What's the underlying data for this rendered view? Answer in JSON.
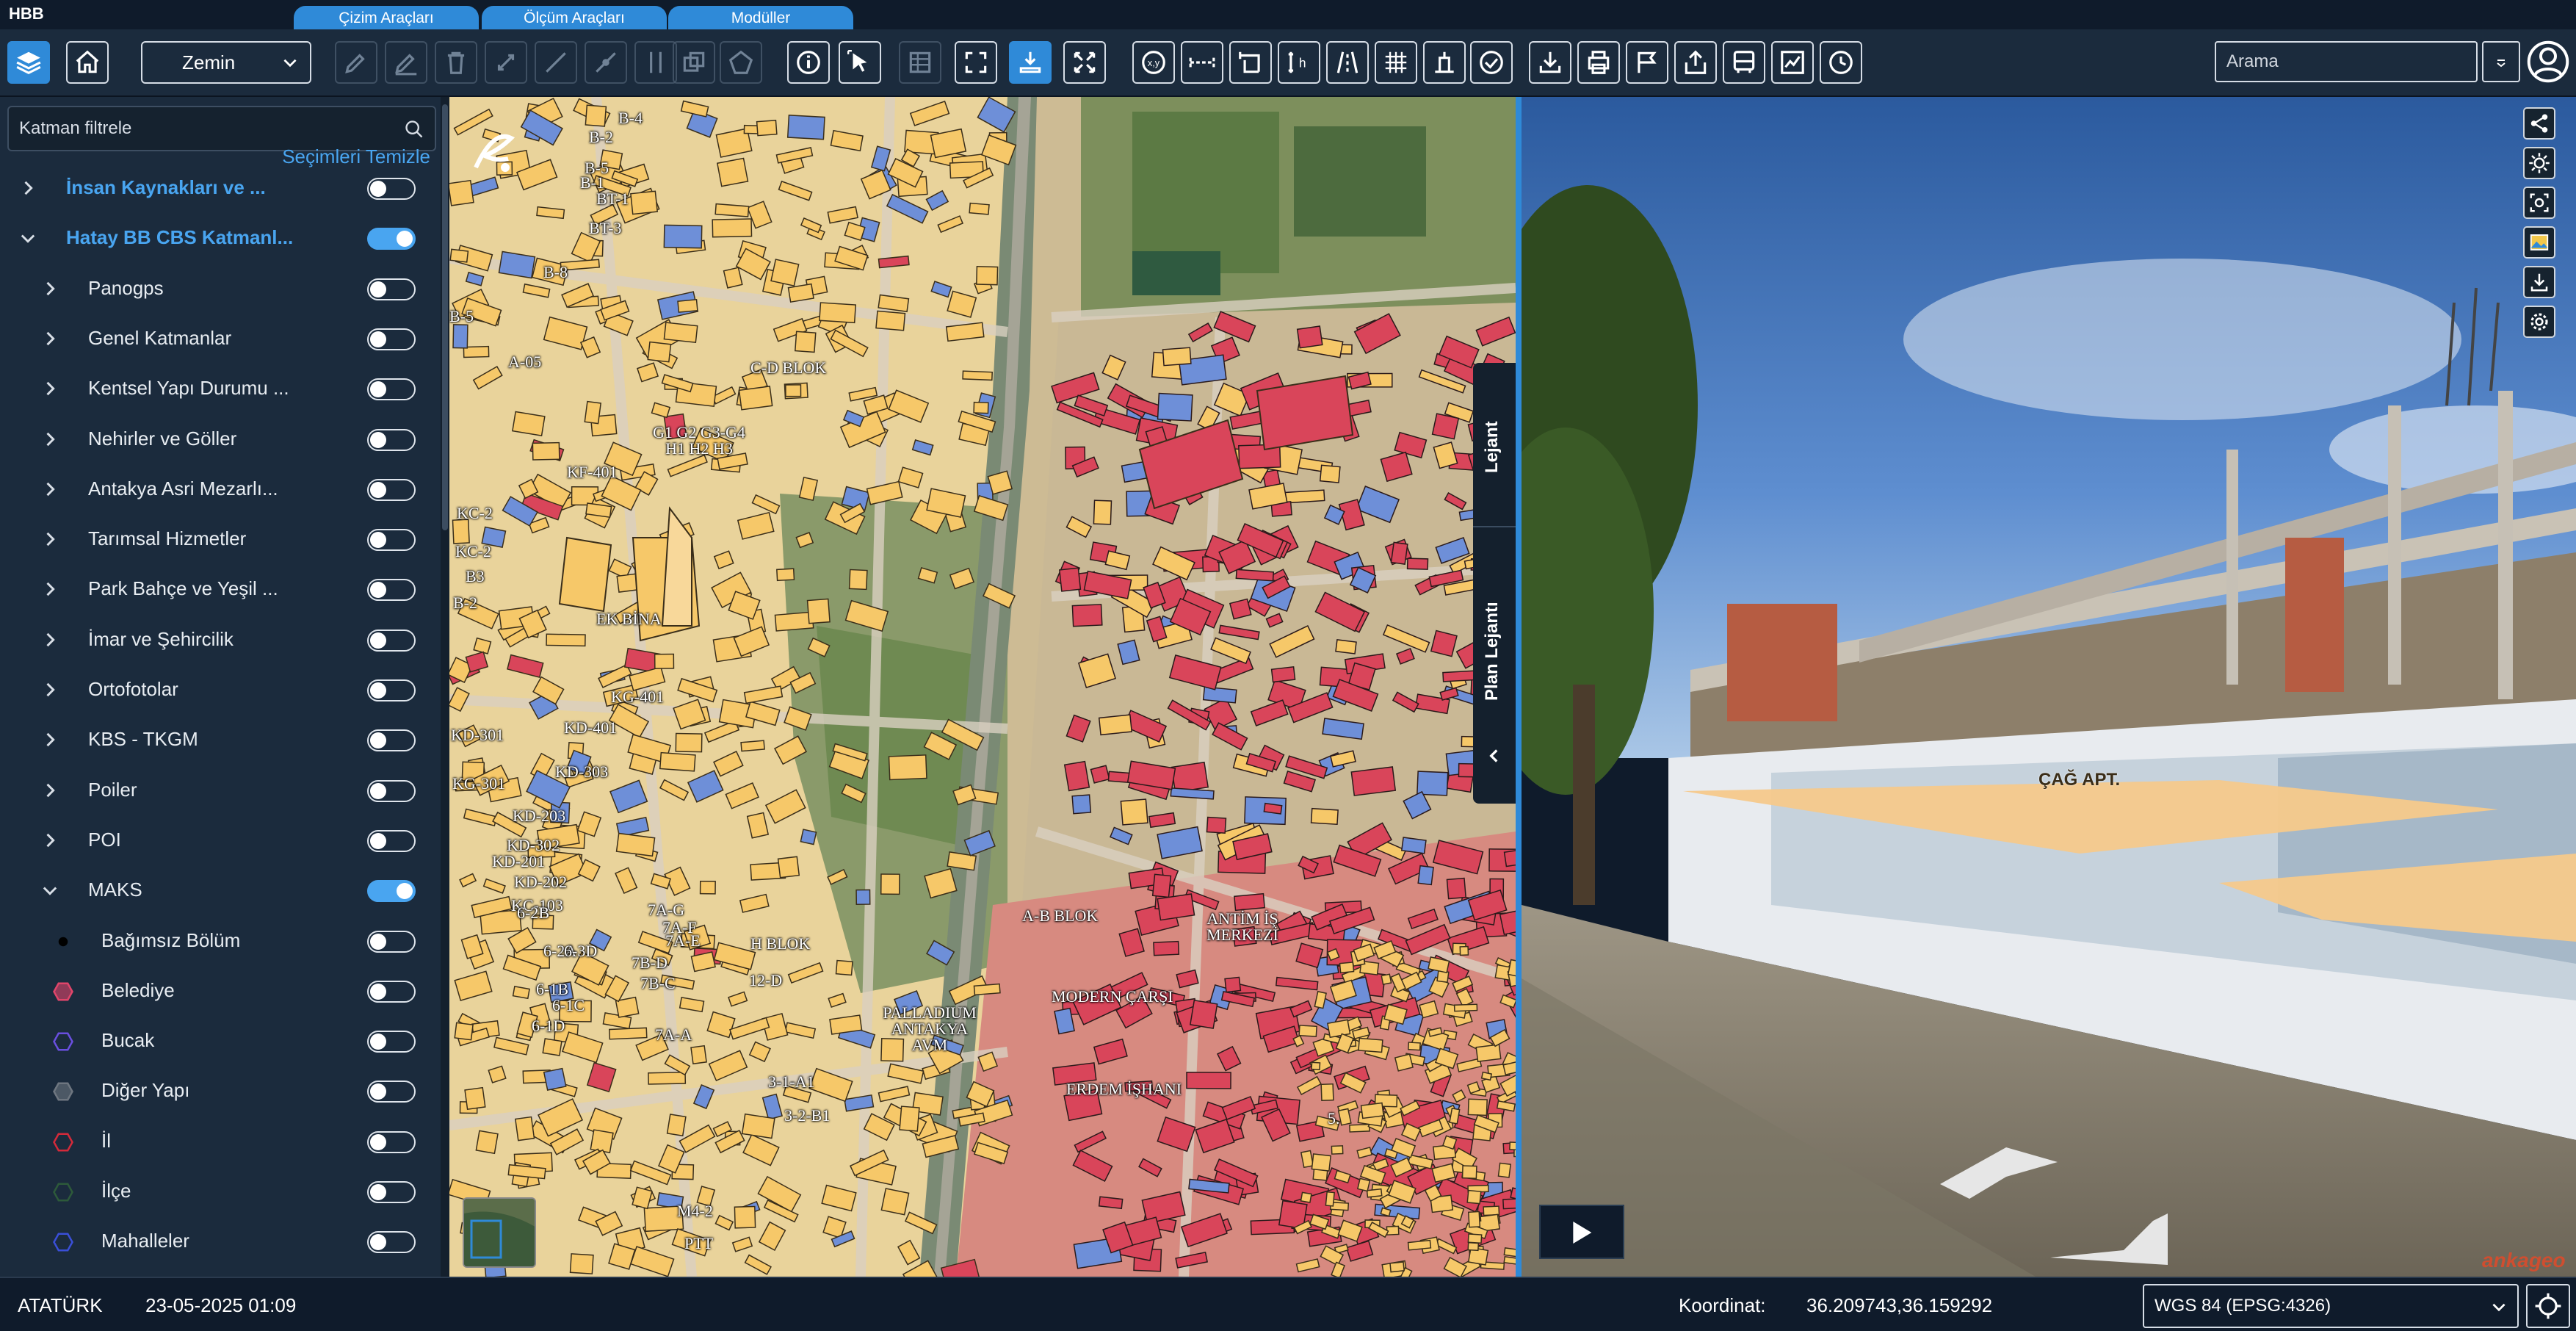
{
  "app": {
    "title": "HBB"
  },
  "top_tabs": [
    "Çizim Araçları",
    "Ölçüm Araçları",
    "Modüller"
  ],
  "toolbar": {
    "basemap_select": "Zemin",
    "search_placeholder": "Arama"
  },
  "sidebar": {
    "filter_placeholder": "Katman filtrele",
    "clear_selection": "Seçimleri Temizle",
    "layers": [
      {
        "label": "İnsan Kaynakları ve ...",
        "on": false
      },
      {
        "label": "Hatay BB CBS Katmanl...",
        "on": true
      },
      {
        "label": "Panogps",
        "on": false
      },
      {
        "label": "Genel Katmanlar",
        "on": false
      },
      {
        "label": "Kentsel Yapı Durumu ...",
        "on": false
      },
      {
        "label": "Nehirler ve Göller",
        "on": false
      },
      {
        "label": "Antakya Asri Mezarlı...",
        "on": false
      },
      {
        "label": "Tarımsal Hizmetler",
        "on": false
      },
      {
        "label": "Park Bahçe ve Yeşil ...",
        "on": false
      },
      {
        "label": "İmar ve Şehircilik",
        "on": false
      },
      {
        "label": "Ortofotolar",
        "on": false
      },
      {
        "label": "KBS - TKGM",
        "on": false
      },
      {
        "label": "Poiler",
        "on": false
      },
      {
        "label": "POI",
        "on": false
      },
      {
        "label": "MAKS",
        "on": true
      },
      {
        "label": "Bağımsız Bölüm",
        "on": false
      },
      {
        "label": "Belediye",
        "on": false
      },
      {
        "label": "Bucak",
        "on": false
      },
      {
        "label": "Diğer Yapı",
        "on": false
      },
      {
        "label": "İl",
        "on": false
      },
      {
        "label": "İlçe",
        "on": false
      },
      {
        "label": "Mahalleler",
        "on": false
      }
    ]
  },
  "map": {
    "legend_tab": "Lejant",
    "plan_legend_tab": "Plan Lejantı",
    "labels": [
      "B-4",
      "B-2",
      "B-5",
      "B-1",
      "BT-1",
      "BT-3",
      "B-8",
      "B-5",
      "A-05",
      "C-D BLOK",
      "G1 G2 G3-G4 H1 H2 H3",
      "KF-401",
      "KC-2",
      "KC-2",
      "B3",
      "B-2",
      "EK BİNA",
      "KG-401",
      "KD-401",
      "KD-301",
      "KD-303",
      "KG-301",
      "KD-203",
      "KD-302",
      "KD-201",
      "KD-202",
      "KC-103",
      "6-2B",
      "6-2A",
      "6-3D",
      "6-1B",
      "6-1C",
      "6-1D",
      "7A-G",
      "7A-F",
      "7A-E",
      "7B-D",
      "7B-C",
      "7A-A",
      "H BLOK",
      "12-D",
      "3-1-A1",
      "3-2-B1",
      "M4-2",
      "PTT",
      "PALLADIUM ANTAKYA AVM",
      "A-B BLOK",
      "ANTİM İŞ MERKEZİ",
      "MODERN ÇARŞI",
      "ERDEM İŞHANI",
      "5."
    ]
  },
  "pano": {
    "building_label": "ÇAĞ APT.",
    "watermark": "ankageo"
  },
  "status": {
    "user": "ATATÜRK",
    "datetime": "23-05-2025 01:09",
    "coord_label": "Koordinat:",
    "coord_value": "36.209743,36.159292",
    "crs": "WGS 84 (EPSG:4326)"
  },
  "colors": {
    "accent": "#2f8ad8",
    "panel": "#1b2b3d",
    "bar": "#0f1b2b",
    "building_yellow": "#f6c869",
    "building_red": "#d9455a",
    "building_blue": "#6e8fd8"
  }
}
